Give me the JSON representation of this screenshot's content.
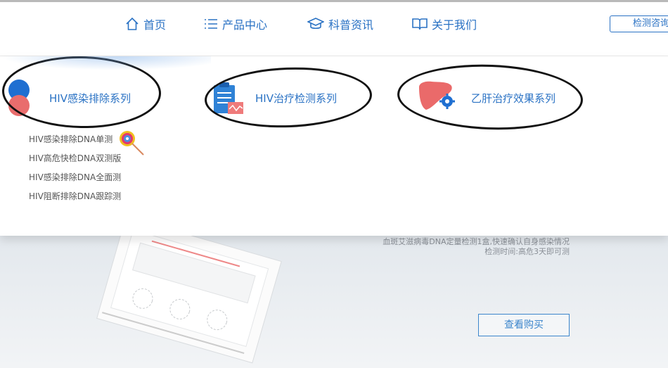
{
  "nav": {
    "items": [
      {
        "label": "首页",
        "icon": "home-icon"
      },
      {
        "label": "产品中心",
        "icon": "list-icon"
      },
      {
        "label": "科普资讯",
        "icon": "graduation-cap-icon"
      },
      {
        "label": "关于我们",
        "icon": "book-icon"
      }
    ],
    "consult_label": "检测咨询"
  },
  "dropdown": {
    "categories": [
      {
        "label": "HIV感染排除系列",
        "icon": "dots-icon"
      },
      {
        "label": "HIV治疗检测系列",
        "icon": "clipboard-icon"
      },
      {
        "label": "乙肝治疗效果系列",
        "icon": "liver-icon"
      }
    ],
    "sub_items": [
      "HIV感染排除DNA单测",
      "HIV高危快检DNA双测版",
      "HIV感染排除DNA全面测",
      "HIV阻断排除DNA跟踪测"
    ],
    "lollipop_icon": "lollipop-icon"
  },
  "banner": {
    "desc_line1": "血斑艾滋病毒DNA定量检测1盒,快速确认自身感染情况",
    "desc_line2": "检测时间:高危3天即可测",
    "buy_label": "查看购买"
  },
  "colors": {
    "accent": "#2a72c4",
    "annotation": "#111111"
  }
}
